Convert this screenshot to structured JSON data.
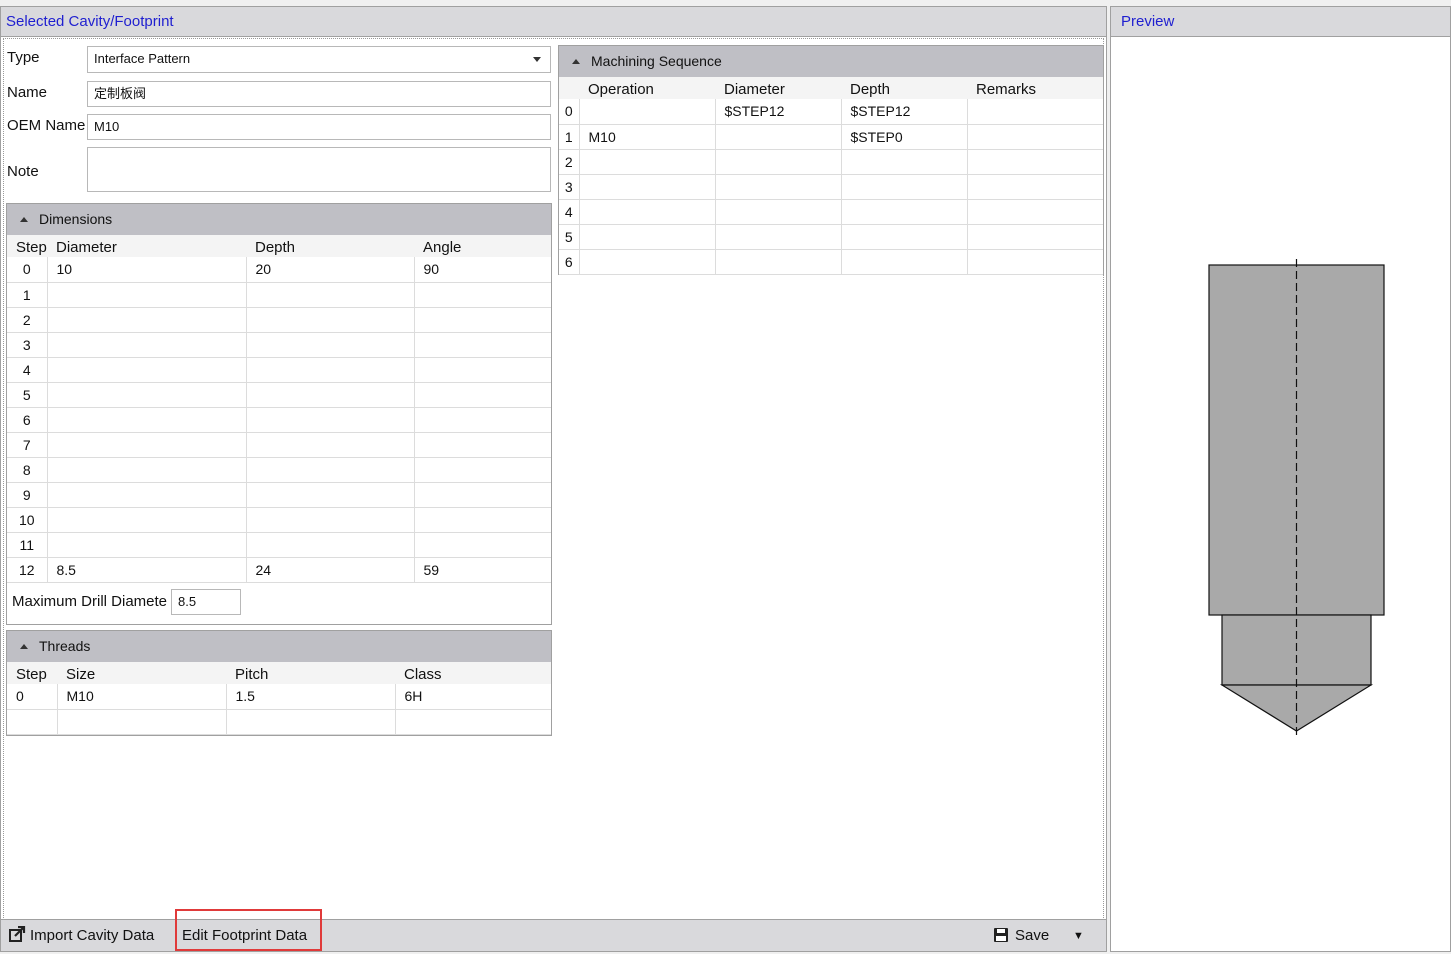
{
  "left_panel": {
    "title": "Selected Cavity/Footprint",
    "fields": {
      "type_label": "Type",
      "type_value": "Interface Pattern",
      "name_label": "Name",
      "name_value": "定制板阀",
      "oem_label": "OEM Name",
      "oem_value": "M10",
      "note_label": "Note",
      "note_value": ""
    },
    "dimensions": {
      "title": "Dimensions",
      "columns": [
        "Step",
        "Diameter",
        "Depth",
        "Angle"
      ],
      "rows": [
        [
          "0",
          "10",
          "20",
          "90"
        ],
        [
          "1",
          "",
          "",
          ""
        ],
        [
          "2",
          "",
          "",
          ""
        ],
        [
          "3",
          "",
          "",
          ""
        ],
        [
          "4",
          "",
          "",
          ""
        ],
        [
          "5",
          "",
          "",
          ""
        ],
        [
          "6",
          "",
          "",
          ""
        ],
        [
          "7",
          "",
          "",
          ""
        ],
        [
          "8",
          "",
          "",
          ""
        ],
        [
          "9",
          "",
          "",
          ""
        ],
        [
          "10",
          "",
          "",
          ""
        ],
        [
          "11",
          "",
          "",
          ""
        ],
        [
          "12",
          "8.5",
          "24",
          "59"
        ]
      ],
      "max_drill_label": "Maximum Drill Diamete",
      "max_drill_value": "8.5"
    },
    "threads": {
      "title": "Threads",
      "columns": [
        "Step",
        "Size",
        "Pitch",
        "Class"
      ],
      "rows": [
        [
          "0",
          "M10",
          "1.5",
          "6H"
        ],
        [
          "",
          "",
          "",
          ""
        ]
      ]
    },
    "machining": {
      "title": "Machining Sequence",
      "columns": [
        "",
        "Operation",
        "Diameter",
        "Depth",
        "Remarks"
      ],
      "rows": [
        [
          "0",
          "",
          "$STEP12",
          "$STEP12",
          ""
        ],
        [
          "1",
          "M10",
          "",
          "$STEP0",
          ""
        ],
        [
          "2",
          "",
          "",
          "",
          ""
        ],
        [
          "3",
          "",
          "",
          "",
          ""
        ],
        [
          "4",
          "",
          "",
          "",
          ""
        ],
        [
          "5",
          "",
          "",
          "",
          ""
        ],
        [
          "6",
          "",
          "",
          "",
          ""
        ]
      ]
    },
    "toolbar": {
      "import_label": "Import Cavity Data",
      "edit_label": "Edit Footprint Data",
      "save_label": "Save",
      "dropdown_glyph": "▼"
    }
  },
  "right_panel": {
    "title": "Preview"
  },
  "colors": {
    "header_text": "#1f1fd0",
    "highlight": "#e03a3a",
    "preview_fill": "#a9a9a9"
  }
}
